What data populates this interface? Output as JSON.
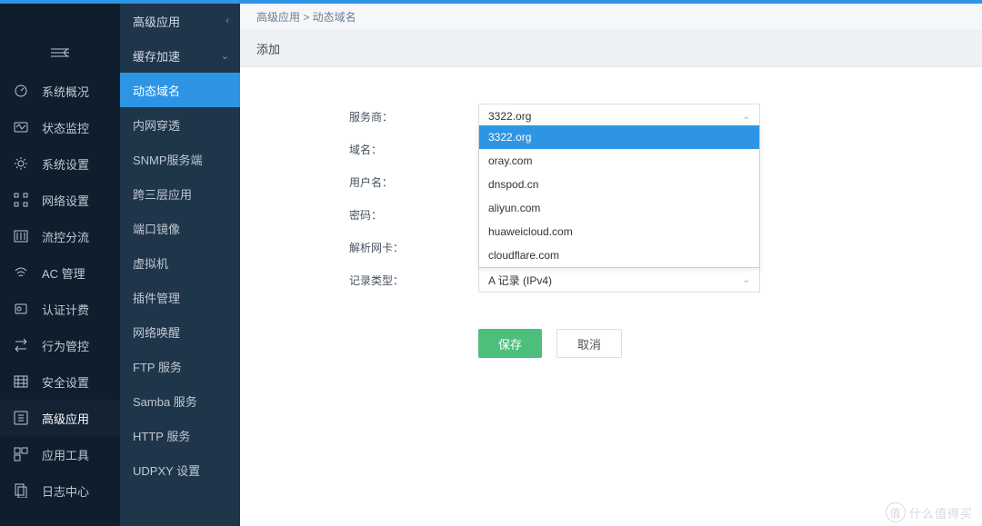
{
  "primary_nav": {
    "items": [
      {
        "label": "系统概况",
        "icon": "dashboard-icon"
      },
      {
        "label": "状态监控",
        "icon": "monitor-icon"
      },
      {
        "label": "系统设置",
        "icon": "gear-icon"
      },
      {
        "label": "网络设置",
        "icon": "network-icon"
      },
      {
        "label": "流控分流",
        "icon": "flow-icon"
      },
      {
        "label": "AC 管理",
        "icon": "wifi-icon"
      },
      {
        "label": "认证计费",
        "icon": "auth-icon"
      },
      {
        "label": "行为管控",
        "icon": "behavior-icon"
      },
      {
        "label": "安全设置",
        "icon": "security-icon"
      },
      {
        "label": "高级应用",
        "icon": "apps-icon",
        "active": true
      },
      {
        "label": "应用工具",
        "icon": "tools-icon"
      },
      {
        "label": "日志中心",
        "icon": "logs-icon"
      }
    ]
  },
  "secondary_nav": {
    "header": "高级应用",
    "group": "缓存加速",
    "items": [
      {
        "label": "动态域名",
        "active": true
      },
      {
        "label": "内网穿透"
      },
      {
        "label": "SNMP服务端"
      },
      {
        "label": "跨三层应用"
      },
      {
        "label": "端口镜像"
      },
      {
        "label": "虚拟机"
      },
      {
        "label": "插件管理"
      },
      {
        "label": "网络唤醒"
      },
      {
        "label": "FTP 服务"
      },
      {
        "label": "Samba 服务"
      },
      {
        "label": "HTTP 服务"
      },
      {
        "label": "UDPXY 设置"
      }
    ]
  },
  "breadcrumb": {
    "path": "高级应用 > 动态域名"
  },
  "page": {
    "title": "添加"
  },
  "form": {
    "provider": {
      "label": "服务商：",
      "value": "3322.org"
    },
    "domain": {
      "label": "域名：",
      "required": true
    },
    "username": {
      "label": "用户名：",
      "required": true
    },
    "password": {
      "label": "密码：",
      "required": true
    },
    "nic": {
      "label": "解析网卡：",
      "required": true
    },
    "record_type": {
      "label": "记录类型：",
      "value": "A 记录 (IPv4)",
      "required": true
    },
    "options": [
      {
        "label": "3322.org",
        "selected": true
      },
      {
        "label": "oray.com"
      },
      {
        "label": "dnspod.cn"
      },
      {
        "label": "aliyun.com"
      },
      {
        "label": "huaweicloud.com"
      },
      {
        "label": "cloudflare.com"
      }
    ]
  },
  "buttons": {
    "save": "保存",
    "cancel": "取消"
  },
  "watermark": {
    "text": "什么值得买",
    "icon": "值"
  }
}
